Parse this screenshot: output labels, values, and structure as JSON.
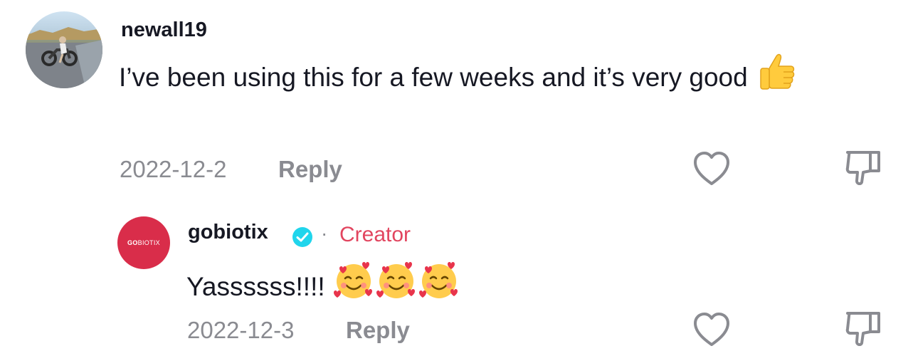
{
  "comments": [
    {
      "username": "newall19",
      "text": "I’ve been using this for a few weeks and it’s very good",
      "emoji": "thumbs-up",
      "date": "2022-12-2",
      "reply_label": "Reply"
    }
  ],
  "reply": {
    "username": "gobiotix",
    "verified_icon": "verified-badge-icon",
    "separator": "·",
    "badge": "Creator",
    "avatar_text_bold": "GO",
    "avatar_text_thin": "BIOTIX",
    "text": "Yassssss!!!!",
    "emoji": [
      "smiling-face-with-hearts",
      "smiling-face-with-hearts",
      "smiling-face-with-hearts"
    ],
    "date": "2022-12-3",
    "reply_label": "Reply"
  },
  "colors": {
    "text": "#161823",
    "muted": "#8a8b91",
    "creator": "#e2455f",
    "brand_avatar": "#d92d4a",
    "verified": "#20d5ec"
  }
}
